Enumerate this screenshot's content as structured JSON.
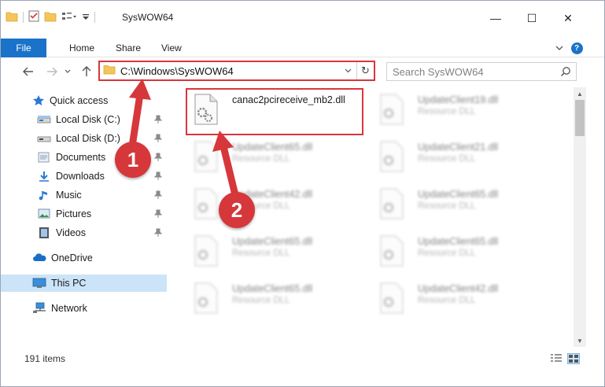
{
  "window": {
    "title": "SysWOW64",
    "controls": {
      "minimize": "—",
      "maximize": "☐",
      "close": "✕"
    }
  },
  "ribbon": {
    "tabs": [
      {
        "label": "File"
      },
      {
        "label": "Home"
      },
      {
        "label": "Share"
      },
      {
        "label": "View"
      }
    ],
    "help_glyph": "?"
  },
  "address": {
    "path": "C:\\Windows\\SysWOW64",
    "refresh_glyph": "↻"
  },
  "search": {
    "placeholder": "Search SysWOW64"
  },
  "sidebar": {
    "items": [
      {
        "label": "Quick access",
        "icon": "star-icon",
        "pinned": false
      },
      {
        "label": "Local Disk (C:)",
        "icon": "drive-icon",
        "pinned": true
      },
      {
        "label": "Local Disk (D:)",
        "icon": "drive-icon",
        "pinned": true
      },
      {
        "label": "Documents",
        "icon": "documents-icon",
        "pinned": true
      },
      {
        "label": "Downloads",
        "icon": "download-icon",
        "pinned": true
      },
      {
        "label": "Music",
        "icon": "music-icon",
        "pinned": true
      },
      {
        "label": "Pictures",
        "icon": "pictures-icon",
        "pinned": true
      },
      {
        "label": "Videos",
        "icon": "videos-icon",
        "pinned": true
      },
      {
        "label": "OneDrive",
        "icon": "cloud-icon",
        "pinned": false
      },
      {
        "label": "This PC",
        "icon": "computer-icon",
        "pinned": false,
        "selected": true
      },
      {
        "label": "Network",
        "icon": "network-icon",
        "pinned": false
      }
    ]
  },
  "files": [
    {
      "name": "canac2pcireceive_mb2.dll",
      "type": "",
      "highlighted": true
    },
    {
      "name": "UpdateClient19.dll",
      "type": "Resource DLL"
    },
    {
      "name": "UpdateClient65.dll",
      "type": "Resource DLL"
    },
    {
      "name": "UpdateClient21.dll",
      "type": "Resource DLL"
    },
    {
      "name": "UpdateClient42.dll",
      "type": "Resource DLL"
    },
    {
      "name": "UpdateClient65.dll",
      "type": "Resource DLL"
    },
    {
      "name": "UpdateClient65.dll",
      "type": "Resource DLL"
    },
    {
      "name": "UpdateClient65.dll",
      "type": "Resource DLL"
    },
    {
      "name": "UpdateClient65.dll",
      "type": "Resource DLL"
    },
    {
      "name": "UpdateClient42.dll",
      "type": "Resource DLL"
    }
  ],
  "status": {
    "item_count": "191 items"
  },
  "callouts": [
    {
      "label": "1"
    },
    {
      "label": "2"
    }
  ],
  "colors": {
    "accent": "#1a73c8",
    "highlight": "#d9363a",
    "selected": "#cce4f7"
  }
}
